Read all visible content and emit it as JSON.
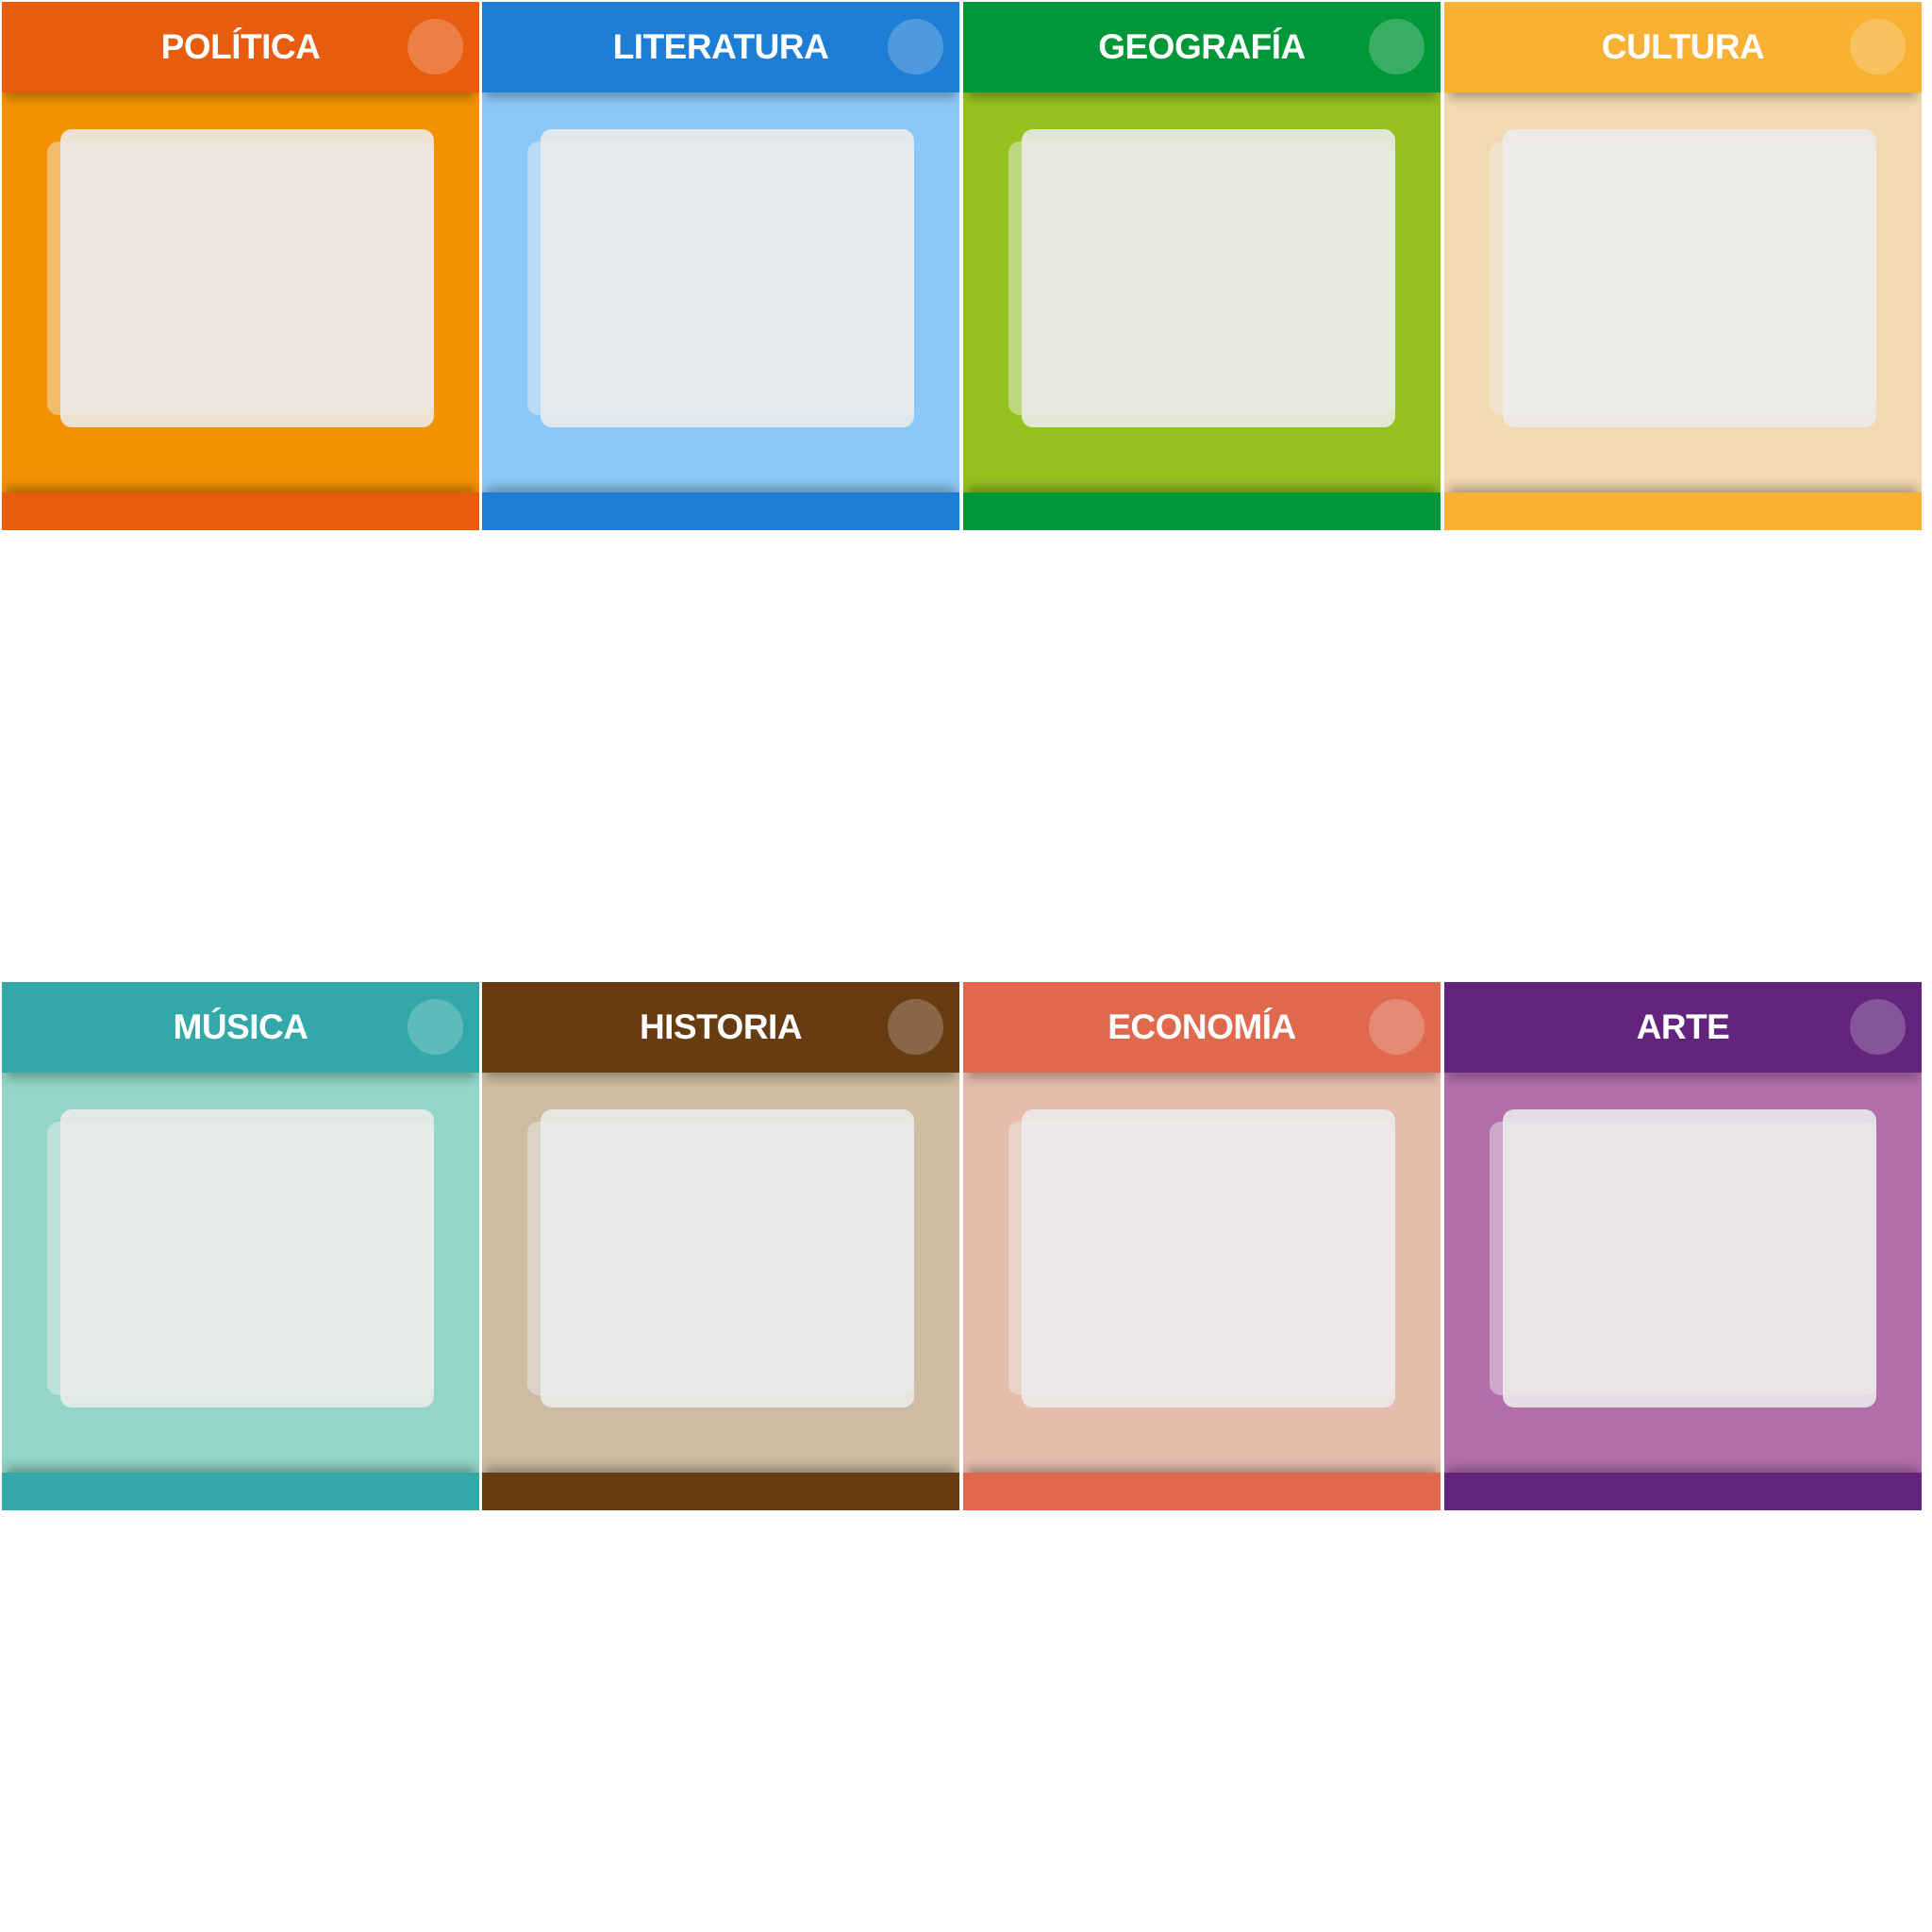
{
  "cards": [
    {
      "title": "POLÍTICA",
      "header_color": "#e85c10",
      "body_color": "#f39200"
    },
    {
      "title": "LITERATURA",
      "header_color": "#1e7ed6",
      "body_color": "#8cc8f7"
    },
    {
      "title": "GEOGRAFÍA",
      "header_color": "#009739",
      "body_color": "#95c11f"
    },
    {
      "title": "CULTURA",
      "header_color": "#f8b133",
      "body_color": "#f3d9b1"
    },
    {
      "title": "MÚSICA",
      "header_color": "#32a8a8",
      "body_color": "#93d5c7"
    },
    {
      "title": "HISTORIA",
      "header_color": "#673c12",
      "body_color": "#cbbca2"
    },
    {
      "title": "ECONOMÍA",
      "header_color": "#df684d",
      "body_color": "#e6bcad"
    },
    {
      "title": "ARTE",
      "header_color": "#63247d",
      "body_color": "#b26eab"
    }
  ]
}
